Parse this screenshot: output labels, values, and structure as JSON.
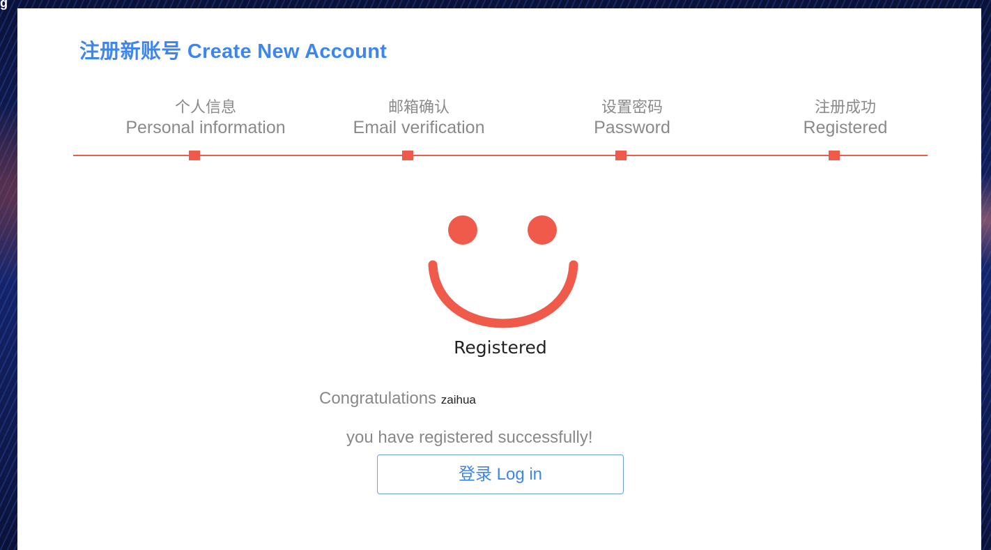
{
  "background": {
    "caption": "g"
  },
  "header": {
    "title": "注册新账号 Create New Account"
  },
  "steps": [
    {
      "cn": "个人信息",
      "en": "Personal information"
    },
    {
      "cn": "邮箱确认",
      "en": "Email verification"
    },
    {
      "cn": "设置密码",
      "en": "Password"
    },
    {
      "cn": "注册成功",
      "en": "Registered"
    }
  ],
  "result": {
    "status": "Registered",
    "congrats_prefix": "Congratulations",
    "username": "zaihua",
    "message": "you have registered successfully!"
  },
  "actions": {
    "login_label": "登录 Log in"
  },
  "colors": {
    "accent": "#3d86f0",
    "progress": "#f05a4a"
  }
}
